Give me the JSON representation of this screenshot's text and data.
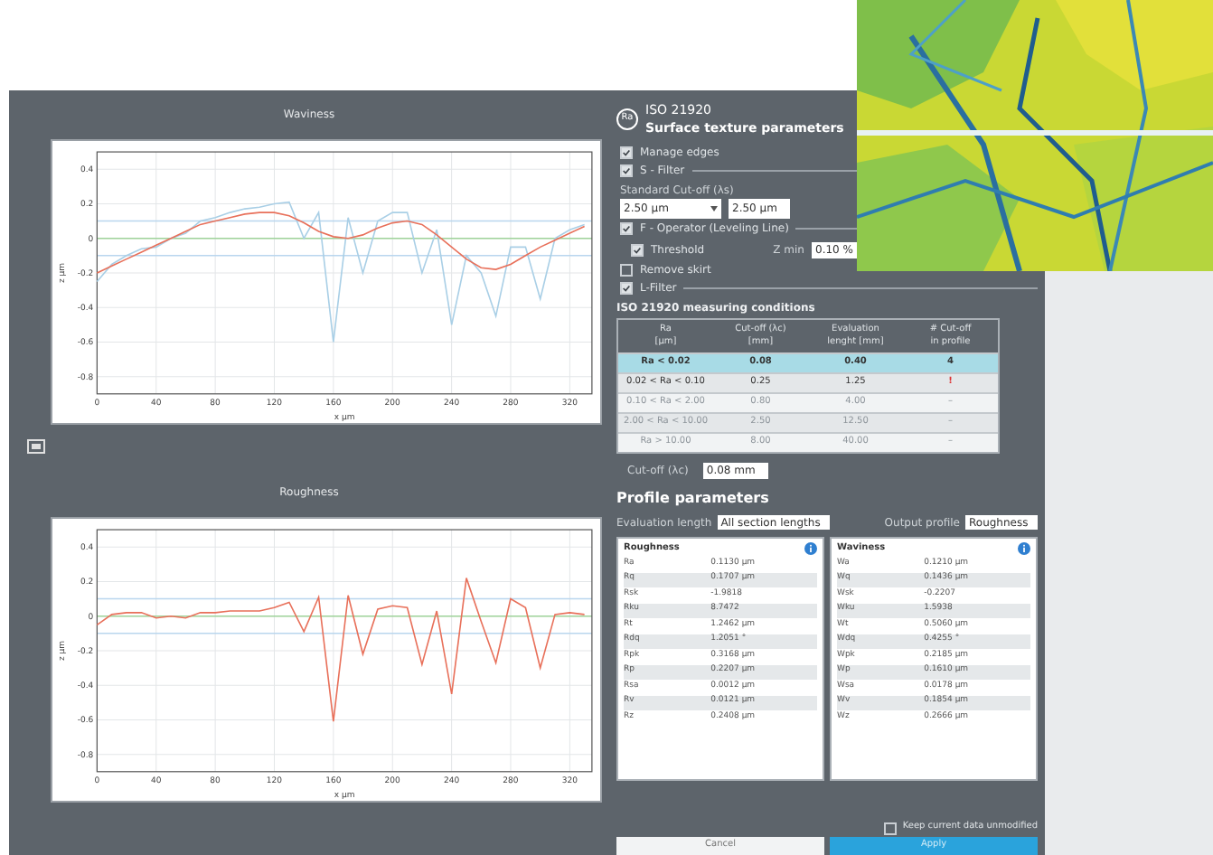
{
  "charts": [
    {
      "title": "Waviness",
      "chart_data": {
        "type": "line",
        "grid": true,
        "ref_lines": [
          {
            "axis": "y",
            "value": 0,
            "color": "#9fd39a"
          },
          {
            "axis": "y",
            "value": 0.1,
            "color": "#b9d6ee"
          },
          {
            "axis": "y",
            "value": -0.1,
            "color": "#b9d6ee"
          }
        ],
        "xlabel": "x µm",
        "ylabel": "z µm",
        "x": [
          0,
          10,
          20,
          30,
          40,
          50,
          60,
          70,
          80,
          90,
          100,
          110,
          120,
          130,
          140,
          150,
          160,
          170,
          180,
          190,
          200,
          210,
          220,
          230,
          240,
          250,
          260,
          270,
          280,
          290,
          300,
          310,
          320,
          330
        ],
        "xlim": [
          0,
          335
        ],
        "ylim": [
          -0.9,
          0.5
        ],
        "xticks": [
          0,
          40,
          80,
          120,
          160,
          200,
          240,
          280,
          320
        ],
        "yticks": [
          0.4,
          0.2,
          0,
          -0.2,
          -0.4,
          -0.6,
          -0.8
        ],
        "series": [
          {
            "color": "#a9cfe6",
            "values": [
              -0.25,
              -0.15,
              -0.1,
              -0.06,
              -0.05,
              0.0,
              0.03,
              0.1,
              0.12,
              0.15,
              0.17,
              0.18,
              0.2,
              0.21,
              0.0,
              0.15,
              -0.6,
              0.12,
              -0.2,
              0.1,
              0.15,
              0.15,
              -0.2,
              0.05,
              -0.5,
              -0.1,
              -0.2,
              -0.45,
              -0.05,
              -0.05,
              -0.35,
              0.0,
              0.05,
              0.08
            ]
          },
          {
            "color": "#e8705a",
            "values": [
              -0.2,
              -0.16,
              -0.12,
              -0.08,
              -0.04,
              0,
              0.04,
              0.08,
              0.1,
              0.12,
              0.14,
              0.15,
              0.15,
              0.13,
              0.09,
              0.04,
              0.01,
              0,
              0.02,
              0.06,
              0.09,
              0.1,
              0.08,
              0.02,
              -0.05,
              -0.12,
              -0.17,
              -0.18,
              -0.15,
              -0.1,
              -0.05,
              -0.01,
              0.03,
              0.07
            ]
          }
        ]
      }
    },
    {
      "title": "Roughness",
      "chart_data": {
        "type": "line",
        "grid": true,
        "ref_lines": [
          {
            "axis": "y",
            "value": 0,
            "color": "#9fd39a"
          },
          {
            "axis": "y",
            "value": 0.1,
            "color": "#b9d6ee"
          },
          {
            "axis": "y",
            "value": -0.1,
            "color": "#b9d6ee"
          }
        ],
        "xlabel": "x µm",
        "ylabel": "z µm",
        "x": [
          0,
          10,
          20,
          30,
          40,
          50,
          60,
          70,
          80,
          90,
          100,
          110,
          120,
          130,
          140,
          150,
          160,
          170,
          180,
          190,
          200,
          210,
          220,
          230,
          240,
          250,
          260,
          270,
          280,
          290,
          300,
          310,
          320,
          330
        ],
        "xlim": [
          0,
          335
        ],
        "ylim": [
          -0.9,
          0.5
        ],
        "xticks": [
          0,
          40,
          80,
          120,
          160,
          200,
          240,
          280,
          320
        ],
        "yticks": [
          0.4,
          0.2,
          0,
          -0.2,
          -0.4,
          -0.6,
          -0.8
        ],
        "series": [
          {
            "color": "#e8705a",
            "values": [
              -0.05,
              0.01,
              0.02,
              0.02,
              -0.01,
              0.0,
              -0.01,
              0.02,
              0.02,
              0.03,
              0.03,
              0.03,
              0.05,
              0.08,
              -0.09,
              0.11,
              -0.61,
              0.12,
              -0.22,
              0.04,
              0.06,
              0.05,
              -0.28,
              0.03,
              -0.45,
              0.22,
              -0.03,
              -0.27,
              0.1,
              0.05,
              -0.3,
              0.01,
              0.02,
              0.01
            ]
          }
        ]
      }
    }
  ],
  "panel": {
    "logo": "Ra",
    "title": "ISO 21920",
    "subtitle": "Surface texture parameters",
    "options": [
      {
        "kind": "check",
        "label": "Manage edges",
        "checked": true
      },
      {
        "kind": "section",
        "label": "S - Filter",
        "checked": true
      },
      {
        "kind": "label",
        "label": "Standard Cut-off (λs)"
      },
      {
        "kind": "inputs",
        "values": [
          "2.50 µm",
          "2.50 µm"
        ]
      },
      {
        "kind": "section",
        "label": "F - Operator (Leveling Line)",
        "checked": true
      },
      {
        "kind": "threshold",
        "label": "Threshold",
        "checked": true,
        "field_label": "Z min",
        "value": "0.10 %"
      },
      {
        "kind": "check",
        "label": "Remove skirt",
        "checked": false
      },
      {
        "kind": "section",
        "label": "L-Filter",
        "checked": true
      }
    ],
    "conditions": {
      "title": "ISO 21920 measuring conditions",
      "columns": [
        "Ra\n[µm]",
        "Cut-off (λc)\n[mm]",
        "Evaluation\nlenght [mm]",
        "# Cut-off\nin profile"
      ],
      "rows": [
        {
          "cells": [
            "Ra < 0.02",
            "0.08",
            "0.40",
            "4"
          ],
          "selected": true,
          "disabled": false,
          "warning": false
        },
        {
          "cells": [
            "0.02 < Ra < 0.10",
            "0.25",
            "1.25",
            "!"
          ],
          "selected": false,
          "disabled": false,
          "warning": true
        },
        {
          "cells": [
            "0.10 < Ra < 2.00",
            "0.80",
            "4.00",
            "–"
          ],
          "selected": false,
          "disabled": true,
          "warning": false
        },
        {
          "cells": [
            "2.00 < Ra < 10.00",
            "2.50",
            "12.50",
            "–"
          ],
          "selected": false,
          "disabled": true,
          "warning": false
        },
        {
          "cells": [
            "Ra > 10.00",
            "8.00",
            "40.00",
            "–"
          ],
          "selected": false,
          "disabled": true,
          "warning": false
        }
      ],
      "cutoff_label": "Cut-off (λc)",
      "cutoff_value": "0.08 mm"
    },
    "profile": {
      "title": "Profile parameters",
      "evaluation_label": "Evaluation length",
      "evaluation_value": "All section lengths",
      "output_label": "Output profile",
      "output_value": "Roughness",
      "tables": [
        {
          "title": "Roughness",
          "rows": [
            [
              "Ra",
              "0.1130 µm"
            ],
            [
              "Rq",
              "0.1707 µm"
            ],
            [
              "Rsk",
              "-1.9818"
            ],
            [
              "Rku",
              "8.7472"
            ],
            [
              "Rt",
              "1.2462 µm"
            ],
            [
              "Rdq",
              "1.2051 °"
            ],
            [
              "Rpk",
              "0.3168 µm"
            ],
            [
              "Rp",
              "0.2207 µm"
            ],
            [
              "Rsa",
              "0.0012 µm"
            ],
            [
              "Rv",
              "0.0121 µm"
            ],
            [
              "Rz",
              "0.2408 µm"
            ]
          ]
        },
        {
          "title": "Waviness",
          "rows": [
            [
              "Wa",
              "0.1210 µm"
            ],
            [
              "Wq",
              "0.1436 µm"
            ],
            [
              "Wsk",
              "-0.2207"
            ],
            [
              "Wku",
              "1.5938"
            ],
            [
              "Wt",
              "0.5060 µm"
            ],
            [
              "Wdq",
              "0.4255 °"
            ],
            [
              "Wpk",
              "0.2185 µm"
            ],
            [
              "Wp",
              "0.1610 µm"
            ],
            [
              "Wsa",
              "0.0178 µm"
            ],
            [
              "Wv",
              "0.1854 µm"
            ],
            [
              "Wz",
              "0.2666 µm"
            ]
          ]
        }
      ]
    },
    "keep": {
      "label": "Keep current data unmodified",
      "checked": false
    },
    "buttons": [
      {
        "label": "Cancel",
        "kind": "secondary"
      },
      {
        "label": "Apply",
        "kind": "primary"
      }
    ]
  }
}
